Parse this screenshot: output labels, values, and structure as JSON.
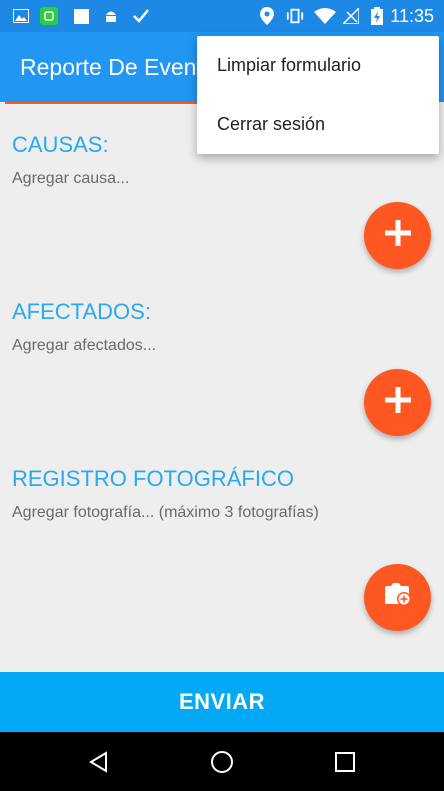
{
  "status_bar": {
    "time": "11:35",
    "left_icons": [
      "gallery-icon",
      "app-icon",
      "square-icon",
      "android-icon",
      "check-icon"
    ],
    "right_icons": [
      "location-icon",
      "vibrate-icon",
      "wifi-icon",
      "signal-icon",
      "battery-icon"
    ]
  },
  "app_bar": {
    "title": "Reporte De Eventos"
  },
  "sections": {
    "causas": {
      "title": "CAUSAS:",
      "hint": "Agregar causa...",
      "action_icon": "plus-icon"
    },
    "afectados": {
      "title": "AFECTADOS:",
      "hint": "Agregar afectados...",
      "action_icon": "plus-icon"
    },
    "registro": {
      "title": "REGISTRO FOTOGRÁFICO",
      "hint": "Agregar fotografía... (máximo 3 fotografías)",
      "action_icon": "add-photo-icon"
    }
  },
  "submit": {
    "label": "ENVIAR"
  },
  "menu": {
    "items": [
      {
        "label": "Limpiar formulario"
      },
      {
        "label": "Cerrar sesión"
      }
    ]
  },
  "nav_bar": {
    "buttons": [
      "back-icon",
      "home-icon",
      "recents-icon"
    ]
  },
  "colors": {
    "primary": "#2196f3",
    "status_bar": "#1e88e5",
    "accent": "#ff5722",
    "section_title": "#29a9ee",
    "submit": "#03a9f4"
  }
}
